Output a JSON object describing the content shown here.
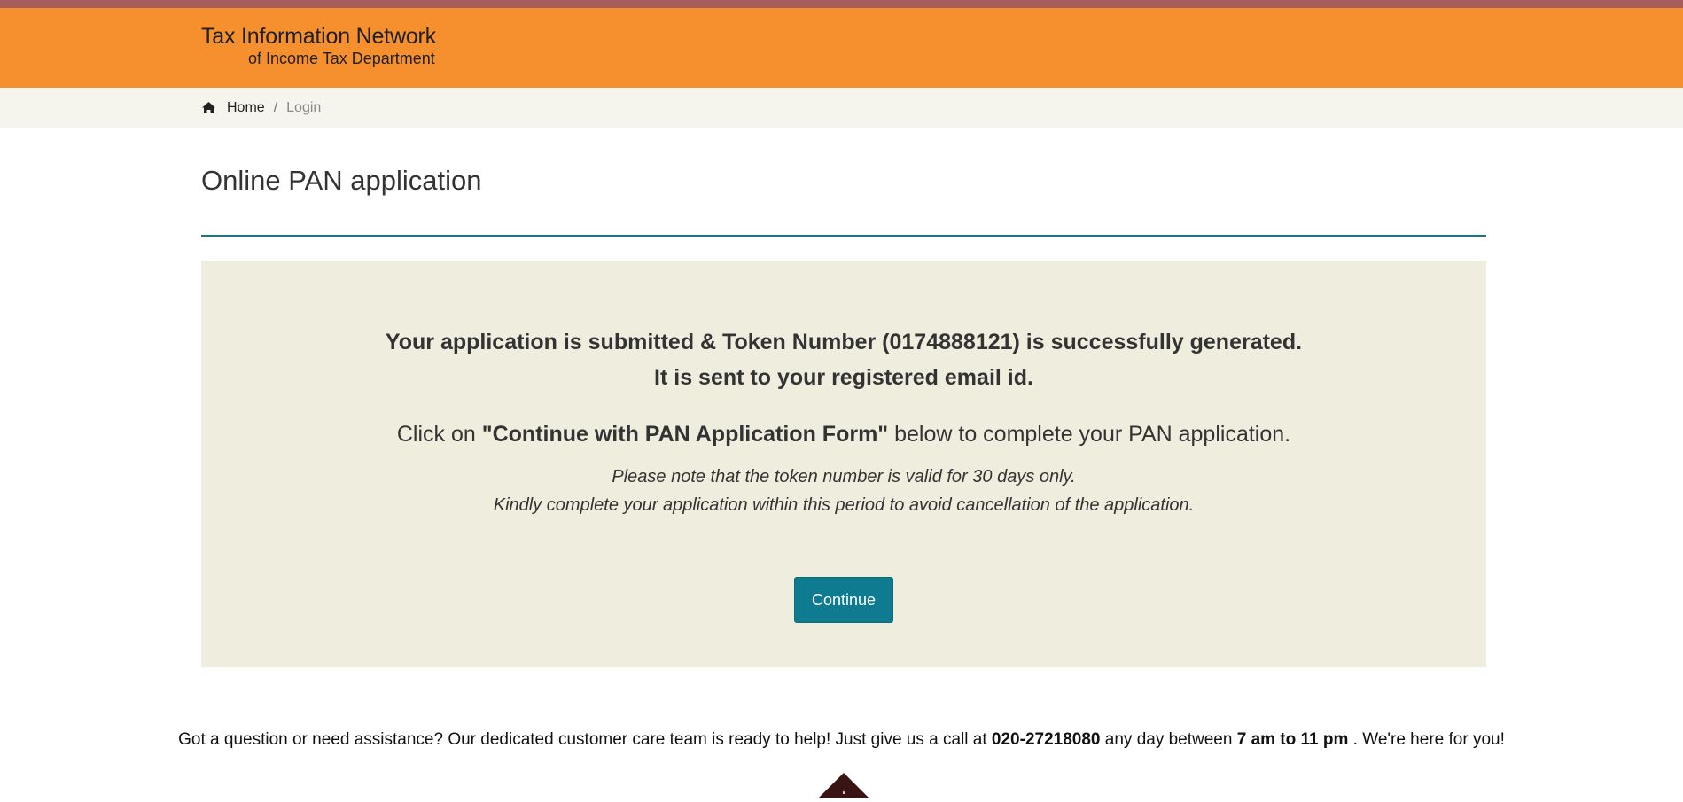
{
  "header": {
    "logo_line1": "Tax Information Network",
    "logo_line2": "of Income Tax Department",
    "bg_color": "#f6902e"
  },
  "breadcrumb": {
    "home_icon": "home-icon",
    "home_label": "Home",
    "separator": "/",
    "current": "Login"
  },
  "page": {
    "title": "Online PAN application"
  },
  "panel": {
    "message_line1": "Your application is submitted & Token Number (0174888121) is successfully generated.",
    "message_line2": "It is sent to your registered email id.",
    "click_prefix": "Click on ",
    "click_bold": "\"Continue with PAN Application Form\"",
    "click_suffix": " below to complete your PAN application.",
    "note_line1": "Please note that the token number is valid for 30 days only.",
    "note_line2": "Kindly complete your application within this period to avoid cancellation of the application.",
    "continue_label": "Continue",
    "accent_color": "#0f7b91"
  },
  "footer": {
    "help_prefix": "Got a question or need assistance? Our dedicated customer care team is ready to help! Just give us a call at ",
    "phone": "020-27218080",
    "help_middle": " any day between ",
    "hours": "7 am to 11 pm",
    "help_suffix": " . We're here for you!",
    "scroll_icon": "scroll-top-icon"
  }
}
